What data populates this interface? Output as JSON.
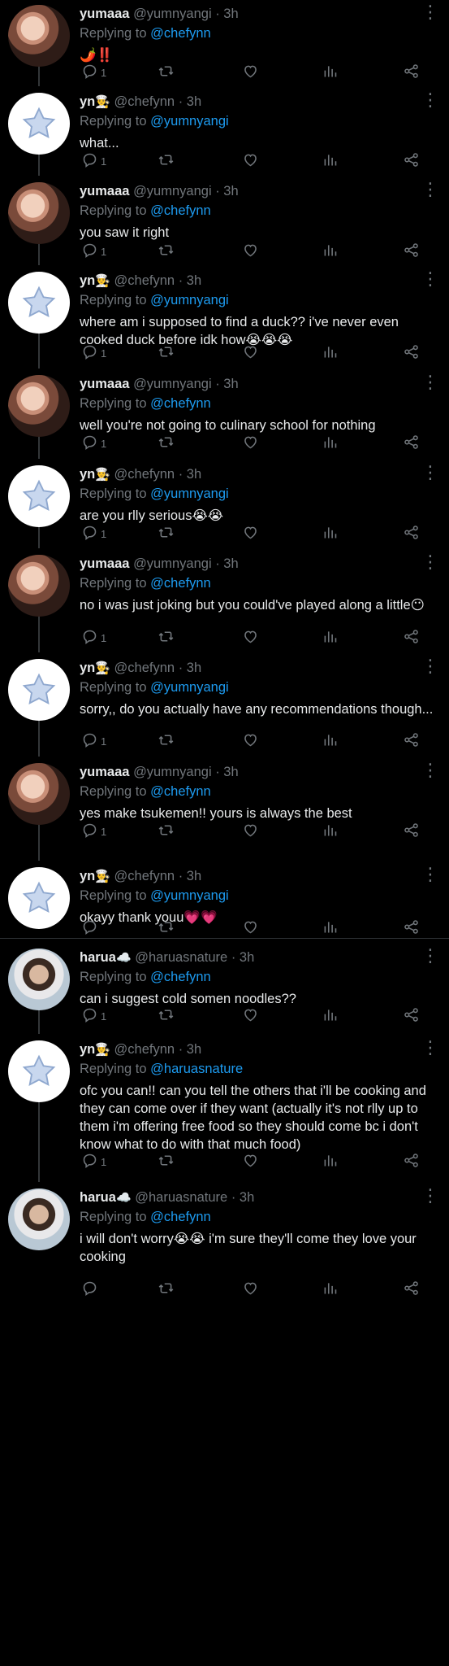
{
  "tweets": [
    {
      "name": "yumaaa",
      "name_emoji": "",
      "handle": "@yumnyangi",
      "time": "· 3h",
      "reply_prefix": "Replying to ",
      "reply_to": "@chefynn",
      "text": "🌶️‼️",
      "reply_count": "1",
      "avatar": "girl"
    },
    {
      "name": "yn",
      "name_emoji": "👨‍🍳",
      "handle": "@chefynn",
      "time": "· 3h",
      "reply_prefix": "Replying to ",
      "reply_to": "@yumnyangi",
      "text": "what...",
      "reply_count": "1",
      "avatar": "star"
    },
    {
      "name": "yumaaa",
      "name_emoji": "",
      "handle": "@yumnyangi",
      "time": "· 3h",
      "reply_prefix": "Replying to ",
      "reply_to": "@chefynn",
      "text": "you saw it right",
      "reply_count": "1",
      "avatar": "girl"
    },
    {
      "name": "yn",
      "name_emoji": "👨‍🍳",
      "handle": "@chefynn",
      "time": "· 3h",
      "reply_prefix": "Replying to ",
      "reply_to": "@yumnyangi",
      "text": "where am i supposed to find a duck?? i've never even cooked duck before idk how😭😭😭",
      "reply_count": "1",
      "avatar": "star"
    },
    {
      "name": "yumaaa",
      "name_emoji": "",
      "handle": "@yumnyangi",
      "time": "· 3h",
      "reply_prefix": "Replying to ",
      "reply_to": "@chefynn",
      "text": "well you're not going to culinary school for nothing",
      "reply_count": "1",
      "avatar": "girl"
    },
    {
      "name": "yn",
      "name_emoji": "👨‍🍳",
      "handle": "@chefynn",
      "time": "· 3h",
      "reply_prefix": "Replying to ",
      "reply_to": "@yumnyangi",
      "text": "are you rlly serious😭😭",
      "reply_count": "1",
      "avatar": "star"
    },
    {
      "name": "yumaaa",
      "name_emoji": "",
      "handle": "@yumnyangi",
      "time": "· 3h",
      "reply_prefix": "Replying to ",
      "reply_to": "@chefynn",
      "text": "no i was just joking but you could've played along a little😶",
      "reply_count": "1",
      "avatar": "girl"
    },
    {
      "name": "yn",
      "name_emoji": "👨‍🍳",
      "handle": "@chefynn",
      "time": "· 3h",
      "reply_prefix": "Replying to ",
      "reply_to": "@yumnyangi",
      "text": "sorry,, do you actually have any recommendations though...",
      "reply_count": "1",
      "avatar": "star"
    },
    {
      "name": "yumaaa",
      "name_emoji": "",
      "handle": "@yumnyangi",
      "time": "· 3h",
      "reply_prefix": "Replying to ",
      "reply_to": "@chefynn",
      "text": "yes make tsukemen!! yours is always the best",
      "reply_count": "1",
      "avatar": "girl"
    },
    {
      "name": "yn",
      "name_emoji": "👨‍🍳",
      "handle": "@chefynn",
      "time": "· 3h",
      "reply_prefix": "Replying to ",
      "reply_to": "@yumnyangi",
      "text": "okayy thank youu💗💗",
      "reply_count": "",
      "avatar": "star"
    },
    {
      "name": "harua",
      "name_emoji": "☁️",
      "handle": "@haruasnature",
      "time": "· 3h",
      "reply_prefix": "Replying to ",
      "reply_to": "@chefynn",
      "text": "can i suggest cold somen noodles??",
      "reply_count": "1",
      "avatar": "boy"
    },
    {
      "name": "yn",
      "name_emoji": "👨‍🍳",
      "handle": "@chefynn",
      "time": "· 3h",
      "reply_prefix": "Replying to ",
      "reply_to": "@haruasnature",
      "text": "ofc you can!! can you tell the others that i'll be cooking and they can come over if they want (actually it's not rlly up to them i'm offering free food so they should come bc i don't know what to do with that much food)",
      "reply_count": "1",
      "avatar": "star"
    },
    {
      "name": "harua",
      "name_emoji": "☁️",
      "handle": "@haruasnature",
      "time": "· 3h",
      "reply_prefix": "Replying to ",
      "reply_to": "@chefynn",
      "text": "i will don't worry😭😭 i'm sure they'll come they love your cooking",
      "reply_count": "",
      "avatar": "boy"
    }
  ]
}
